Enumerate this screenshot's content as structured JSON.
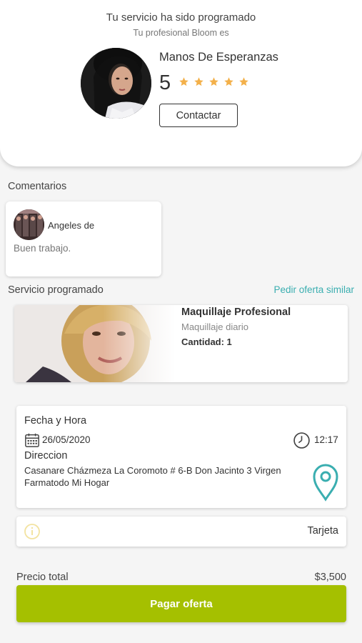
{
  "header": {
    "title": "Tu servicio ha sido programado",
    "subtitle": "Tu profesional Bloom es"
  },
  "professional": {
    "name": "Manos De Esperanzas",
    "rating": "5",
    "stars": 5,
    "contact_label": "Contactar"
  },
  "comments": {
    "section_label": "Comentarios",
    "items": [
      {
        "author": "Angeles de",
        "text": "Buen trabajo."
      }
    ]
  },
  "service": {
    "section_label": "Servicio programado",
    "similar_link": "Pedir oferta similar",
    "name": "Maquillaje Profesional",
    "type": "Maquillaje diario",
    "quantity": "Cantidad: 1"
  },
  "schedule": {
    "datetime_label": "Fecha y Hora",
    "date": "26/05/2020",
    "time": "12:17",
    "address_label": "Direccion",
    "address": "Casanare  Cházmeza La Coromoto # 6-B Don Jacinto 3 Virgen Farmatodo  Mi Hogar"
  },
  "payment": {
    "method": "Tarjeta"
  },
  "total": {
    "label": "Precio total",
    "value": "$3,500"
  },
  "pay_button": "Pagar oferta",
  "colors": {
    "accent_teal": "#3aaeb0",
    "pay_green": "#a5c000",
    "star_orange": "#f3b04a"
  },
  "icons": [
    "calendar-icon",
    "clock-icon",
    "location-pin-icon",
    "info-icon",
    "star-icon"
  ]
}
